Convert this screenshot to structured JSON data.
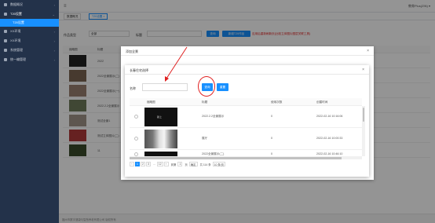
{
  "sidebar": {
    "items": [
      {
        "label": "数据概况",
        "expanded": false
      },
      {
        "label": "T20设置",
        "expanded": true
      },
      {
        "label": "T20设置",
        "sub": true
      },
      {
        "label": "XX环境",
        "expanded": false
      },
      {
        "label": "XX环境",
        "expanded": false
      },
      {
        "label": "系统管理",
        "expanded": false
      },
      {
        "label": "统一编管理",
        "expanded": false
      }
    ]
  },
  "header": {
    "user": "教育Plus(ZIN) ▾"
  },
  "tabs": [
    "数据概况",
    "T20设置 ×"
  ],
  "filters": {
    "type_label": "作品类型",
    "type_value": "全部",
    "title_label": "标题",
    "query_btn": "查询",
    "add_btn": "新增T20作品",
    "warning": "应用后重新刷新页(比较立体图片图层关联工具)"
  },
  "bg_table": {
    "header": "缩略图",
    "header2": "标题",
    "rows": [
      {
        "title": "2022"
      },
      {
        "title": "2022全景展示(二)"
      },
      {
        "title": "2022全景展示(一)"
      },
      {
        "title": "2022.2.2全景展示"
      },
      {
        "title": "测试全景1"
      },
      {
        "title": "测试立体图片(二)"
      },
      {
        "title": "11",
        "user": "用户",
        "date": "2023-09-27",
        "status": "已发布"
      }
    ],
    "pager": "共 201 条"
  },
  "footer": "福州市数字健康与智慧养老有限公司 版权所有",
  "outer_dialog": {
    "title": "添加全景"
  },
  "inner_dialog": {
    "title": "长春住宅选择",
    "search_label": "名称",
    "search_placeholder": "",
    "query_btn": "查询",
    "reset_btn": "重置",
    "columns": [
      "缩略图",
      "标题",
      "使用次数",
      "创建时间"
    ],
    "rows": [
      {
        "thumb_text": "献上",
        "title": "2022.2.2全景展示",
        "count": "0",
        "created": "2022-02-16 10:16:06"
      },
      {
        "thumb_text": "",
        "title": "展厅",
        "count": "0",
        "created": "2022-02-16 10:00:33"
      },
      {
        "thumb_text": "献上",
        "title": "2022全景展示(二)",
        "count": "0",
        "created": "2022-02-16 10:46:10"
      }
    ],
    "pager": {
      "prev": "‹",
      "pages": [
        "1",
        "2",
        "3",
        "...",
        "12"
      ],
      "next": "›",
      "goto_label": "到第",
      "goto_value": "1",
      "page_unit": "页",
      "confirm": "确定",
      "total": "共 114 条",
      "page_size": "10 条/页"
    }
  },
  "colors": {
    "primary": "#1890ff",
    "sidebar": "#23324a",
    "annotation": "#e02020"
  }
}
